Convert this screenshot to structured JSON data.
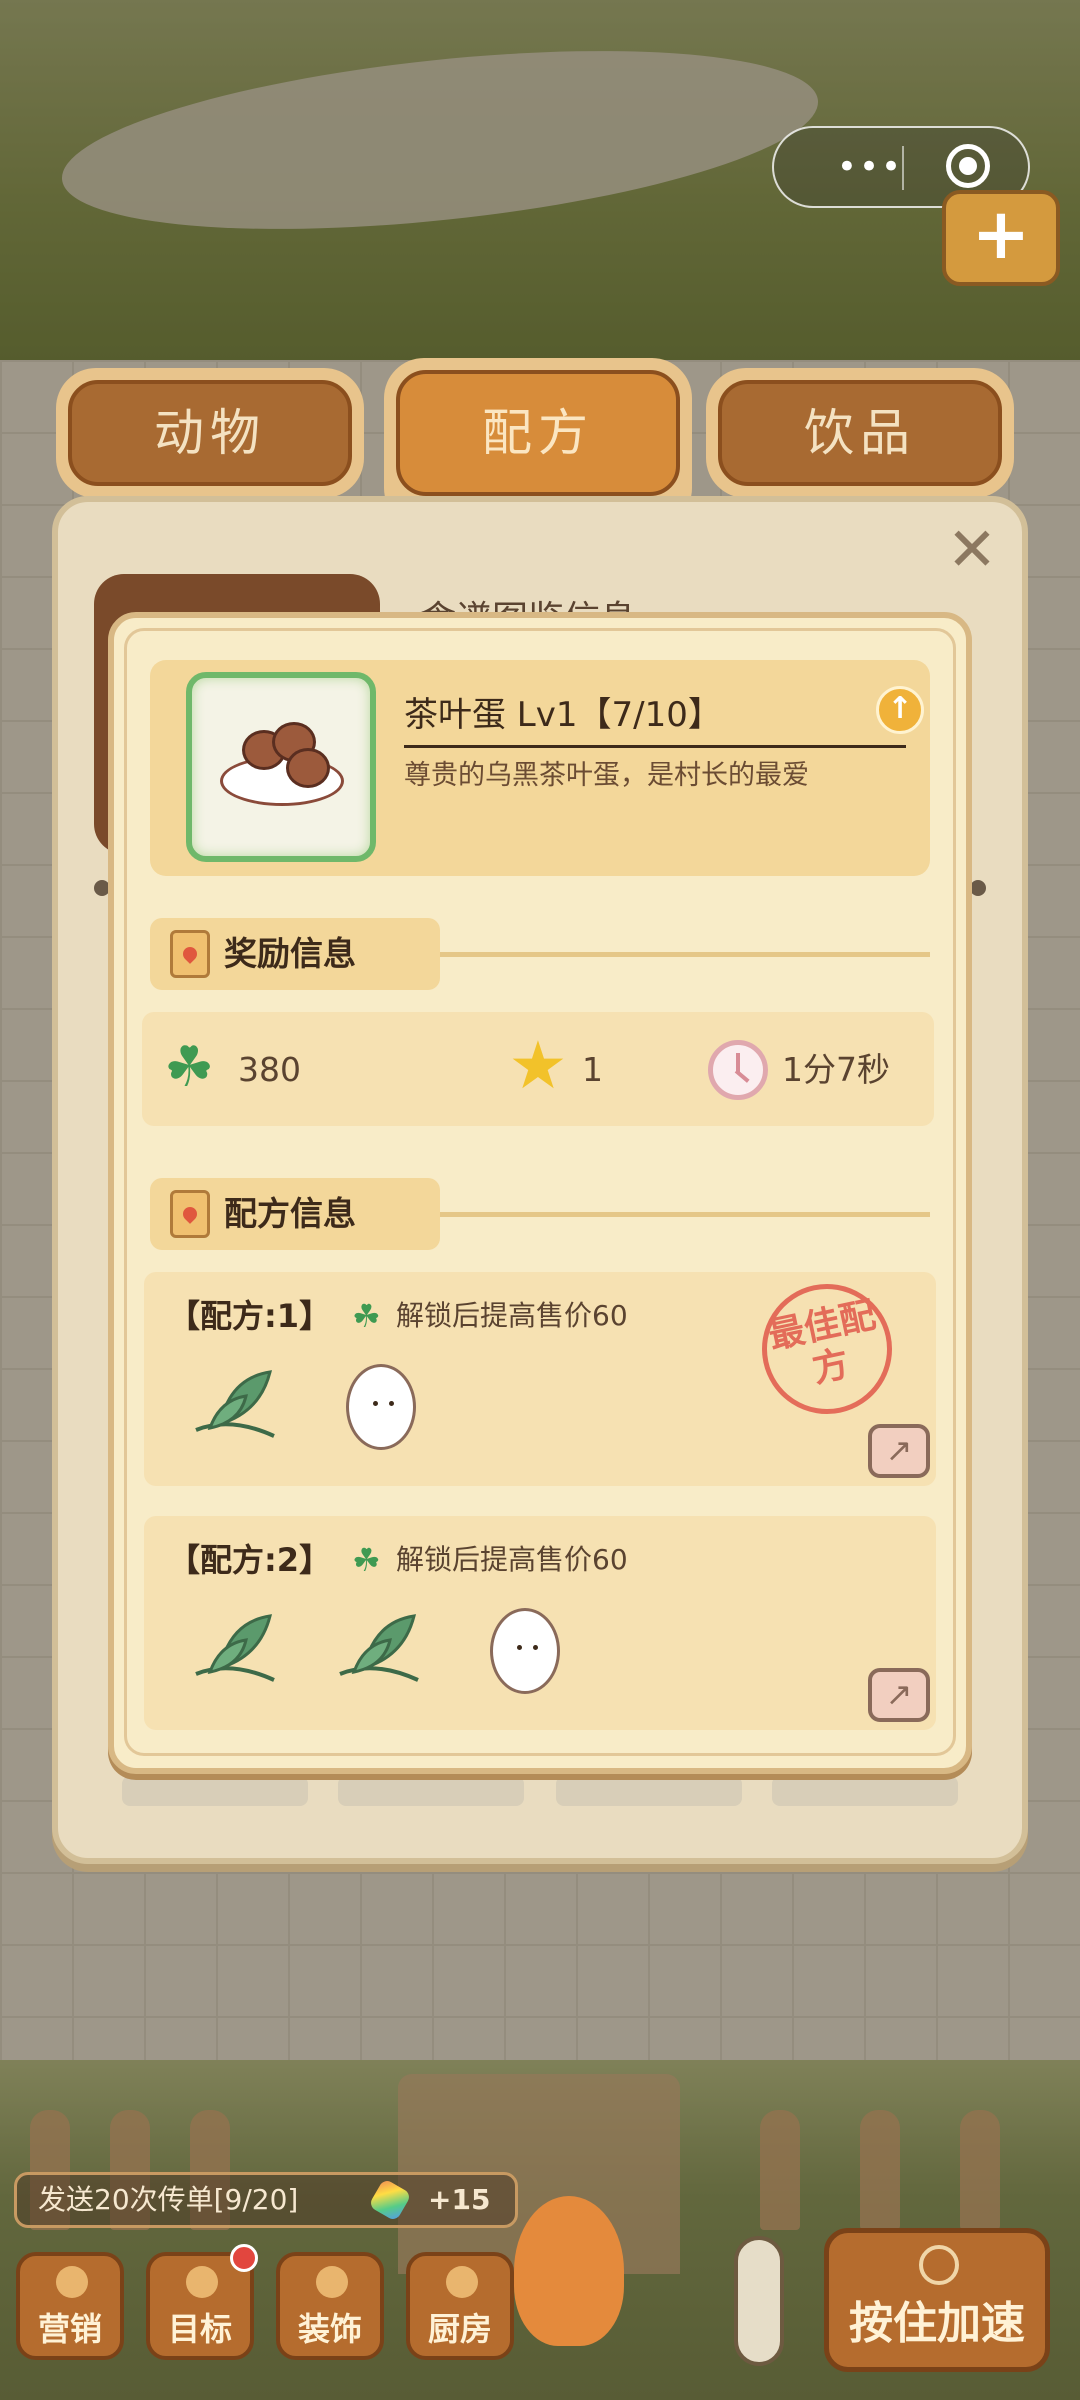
{
  "capsule": {
    "dots": "•••"
  },
  "tabs": [
    {
      "label": "动物"
    },
    {
      "label": "配方"
    },
    {
      "label": "饮品"
    }
  ],
  "outer": {
    "title_peek": "食谱图鉴信息"
  },
  "item": {
    "name": "茶叶蛋 Lv1【7/10】",
    "description": "尊贵的乌黑茶叶蛋，是村长的最爱"
  },
  "reward_section": {
    "title": "奖励信息",
    "clover": "380",
    "star": "1",
    "time": "1分7秒"
  },
  "recipe_section": {
    "title": "配方信息",
    "recipes": [
      {
        "title": "【配方:1】",
        "unlock": "解锁后提高售价60",
        "best": "最佳配方"
      },
      {
        "title": "【配方:2】",
        "unlock": "解锁后提高售价60"
      }
    ]
  },
  "bottom": {
    "task": "发送20次传单[9/20]",
    "task_reward": "+15",
    "nav": [
      {
        "label": "营销"
      },
      {
        "label": "目标"
      },
      {
        "label": "装饰"
      },
      {
        "label": "厨房"
      }
    ],
    "speed": "按住加速"
  },
  "colors": {
    "accent": "#b56c2e",
    "clover": "#3f9a52",
    "star": "#f2c22a",
    "stamp": "#e0584a"
  }
}
